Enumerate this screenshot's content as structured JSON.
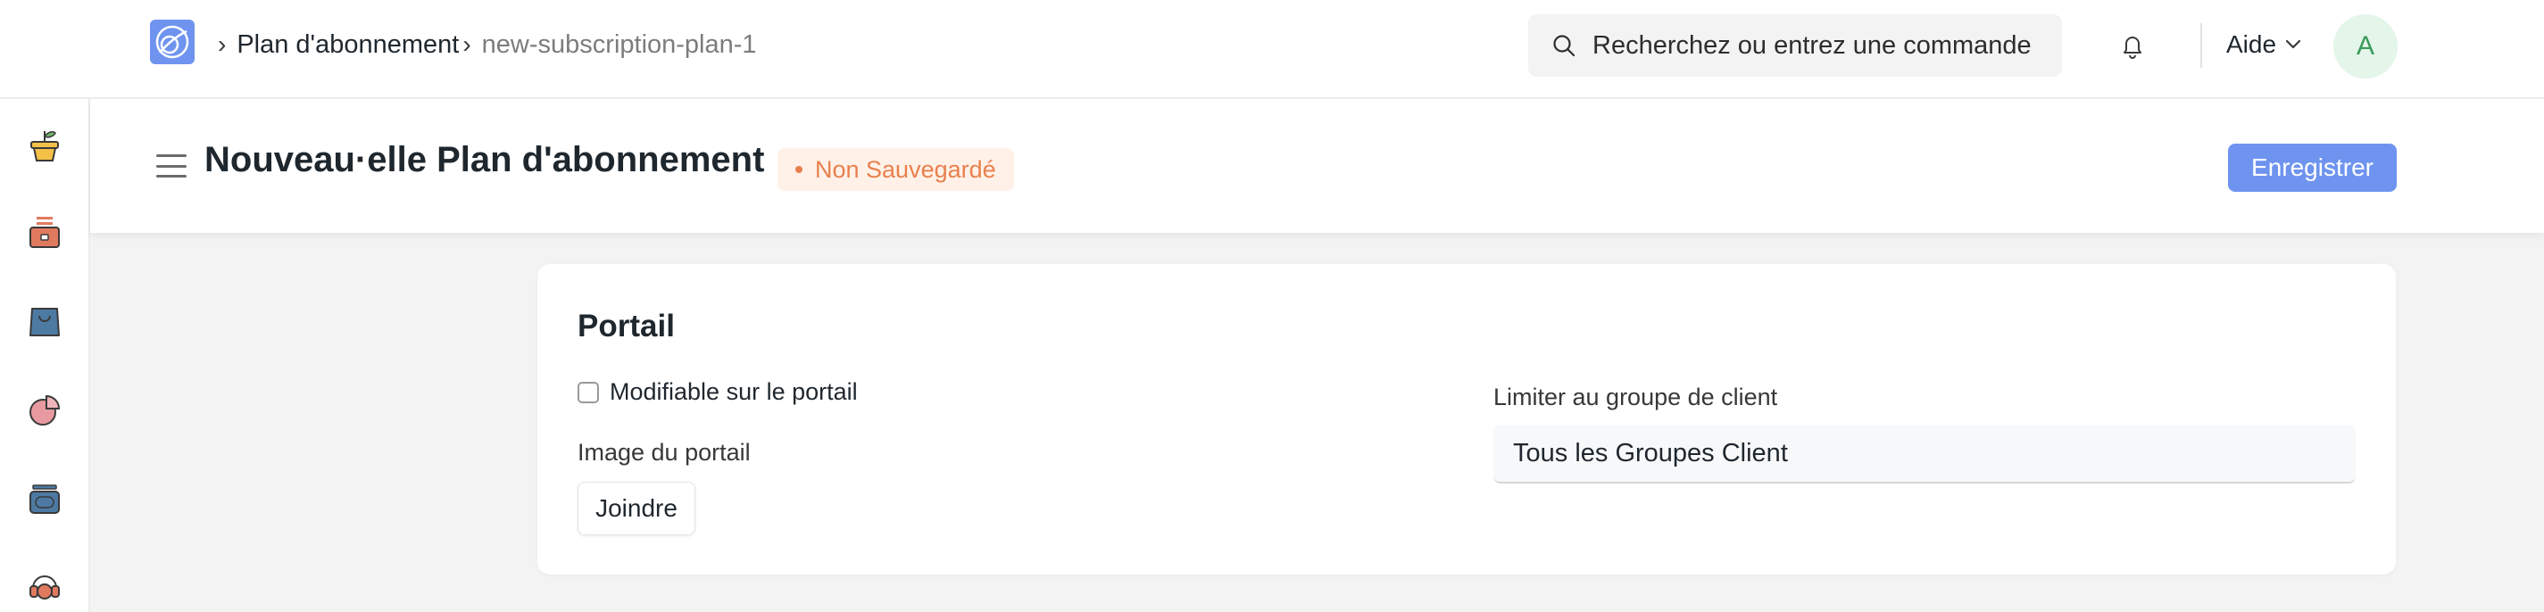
{
  "navbar": {
    "breadcrumbs": [
      "Plan d'abonnement",
      "new-subscription-plan-1"
    ],
    "search_placeholder": "Recherchez ou entrez une commande",
    "help_label": "Aide",
    "avatar_initial": "A"
  },
  "sidebar": {
    "icons": [
      "plant-pot-icon",
      "cash-box-icon",
      "shopping-bag-icon",
      "pie-chart-icon",
      "card-stack-icon",
      "headset-icon"
    ]
  },
  "page": {
    "title": "Nouveau·elle Plan d'abonnement",
    "status": "Non Sauvegardé",
    "save_label": "Enregistrer"
  },
  "form": {
    "section_title": "Portail",
    "editable_label": "Modifiable sur le portail",
    "editable_checked": false,
    "image_label": "Image du portail",
    "attach_label": "Joindre",
    "customer_group_label": "Limiter au groupe de client",
    "customer_group_value": "Tous les Groupes Client"
  },
  "colors": {
    "primary": "#6f94ef",
    "status_orange": "#e8804e",
    "status_bg": "#fff1e7",
    "avatar_bg": "#e4f5e9",
    "avatar_fg": "#3a9a5b"
  }
}
